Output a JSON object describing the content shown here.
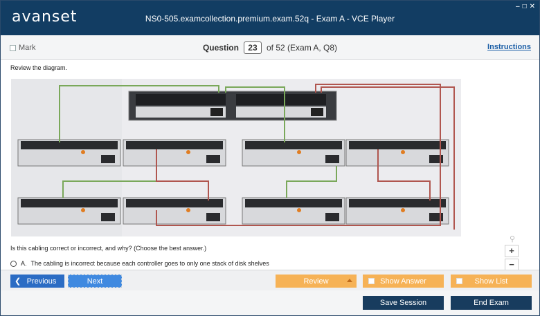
{
  "app": {
    "logo": "avanset",
    "window_title": "NS0-505.examcollection.premium.exam.52q - Exam A - VCE Player",
    "min_icon": "minimize-icon",
    "max_icon": "maximize-icon",
    "close_icon": "close-icon"
  },
  "question_bar": {
    "mark_label": "Mark",
    "question_label": "Question",
    "question_number": "23",
    "question_suffix": "of 52 (Exam A, Q8)",
    "instructions_label": "Instructions"
  },
  "content": {
    "prompt": "Review the diagram.",
    "question_text": "Is this cabling correct or incorrect, and why? (Choose the best answer.)",
    "answer_a_letter": "A.",
    "answer_a_text": "The cabling is incorrect because each controller goes to only one stack of disk shelves"
  },
  "zoom": {
    "zoom_icon": "magnifier-icon",
    "plus": "+",
    "minus": "−"
  },
  "nav": {
    "previous": "Previous",
    "next": "Next",
    "review": "Review",
    "show_answer": "Show Answer",
    "show_list": "Show List"
  },
  "bottom": {
    "save_session": "Save Session",
    "end_exam": "End Exam"
  },
  "colors": {
    "titlebar": "#123d63",
    "primary_button": "#2b6cc4",
    "orange_button": "#f6b256",
    "dark_button": "#183c5e",
    "cable_green": "#7aa85a",
    "cable_red": "#b0564f"
  }
}
